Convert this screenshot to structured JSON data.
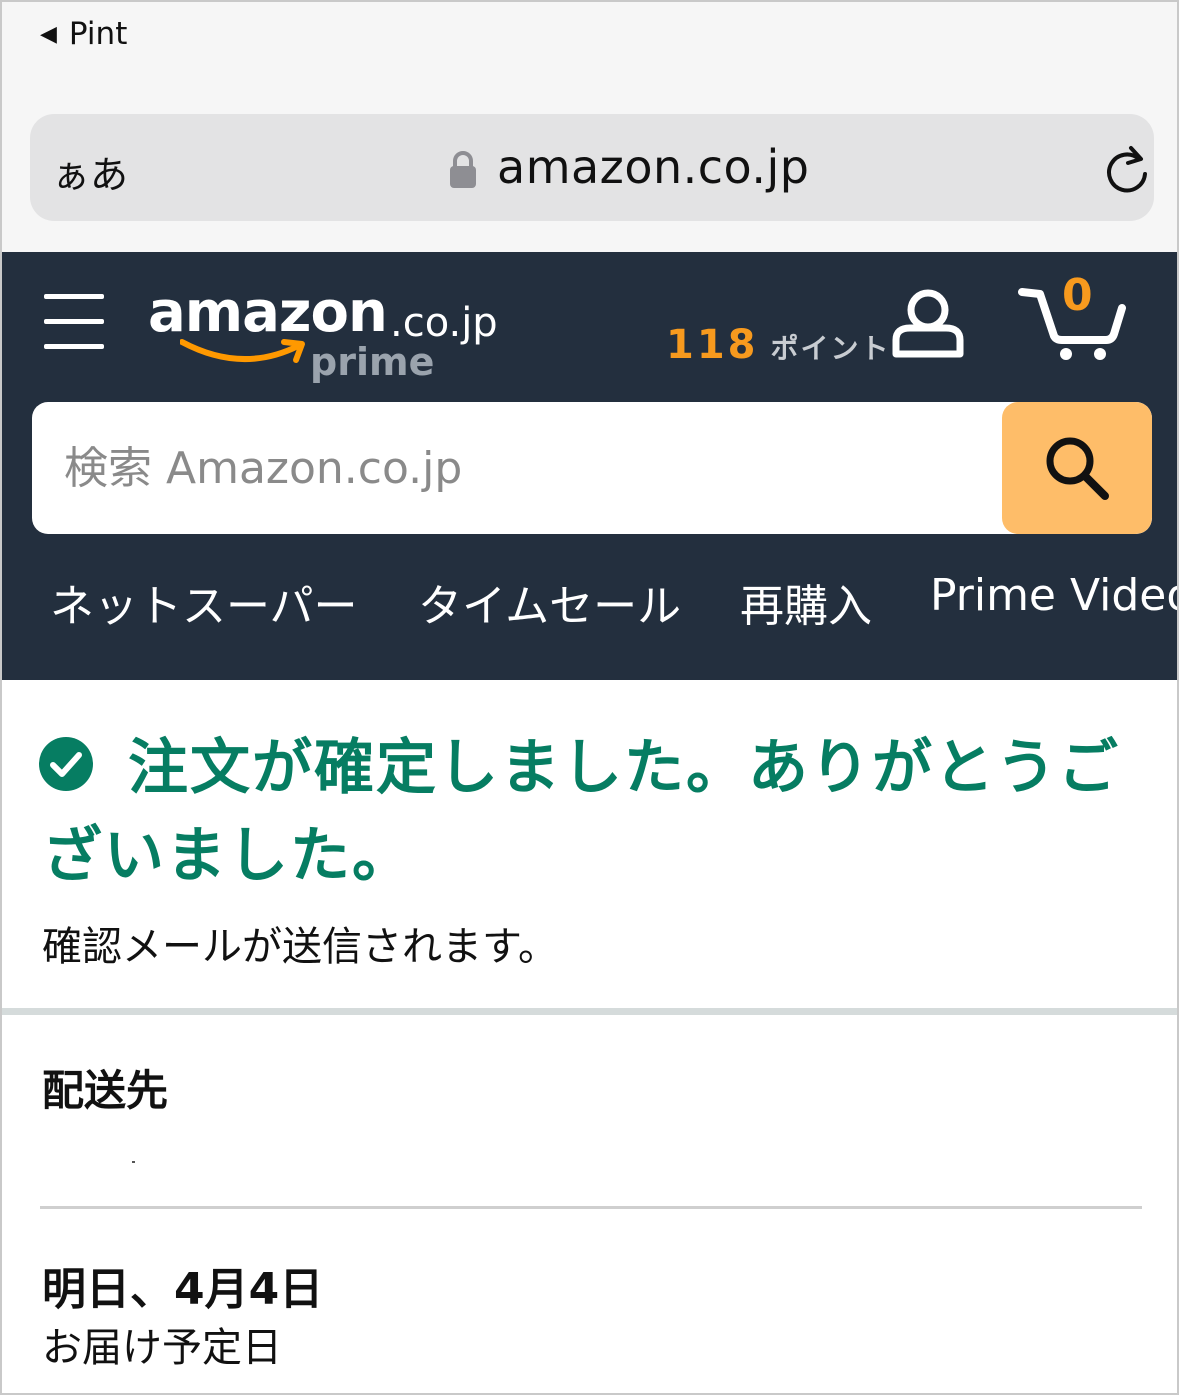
{
  "status_bar": {
    "back_app": "Pint"
  },
  "browser": {
    "text_size_label": "ぁあ",
    "domain": "amazon.co.jp",
    "icons": {
      "lock": "lock-icon",
      "reload": "reload-icon"
    }
  },
  "header": {
    "logo_word": "amazon",
    "logo_tld": ".co.jp",
    "logo_prime": "prime",
    "points_value": "118",
    "points_label": "ポイント",
    "cart_count": "0",
    "colors": {
      "background": "#232f3e",
      "accent": "#f79a1e",
      "search_button": "#febd69"
    }
  },
  "search": {
    "placeholder": "検索 Amazon.co.jp"
  },
  "nav": {
    "items": [
      {
        "label": "ネットスーパー"
      },
      {
        "label": "タイムセール"
      },
      {
        "label": "再購入"
      },
      {
        "label": "Prime Video"
      }
    ]
  },
  "confirmation": {
    "title": "注文が確定しました。ありがとうございました。",
    "subtitle": "確認メールが送信されます。",
    "color": "#067d62"
  },
  "shipping": {
    "label": "配送先",
    "delivery_date": "明日、4月4日",
    "delivery_date_label": "お届け予定日"
  }
}
